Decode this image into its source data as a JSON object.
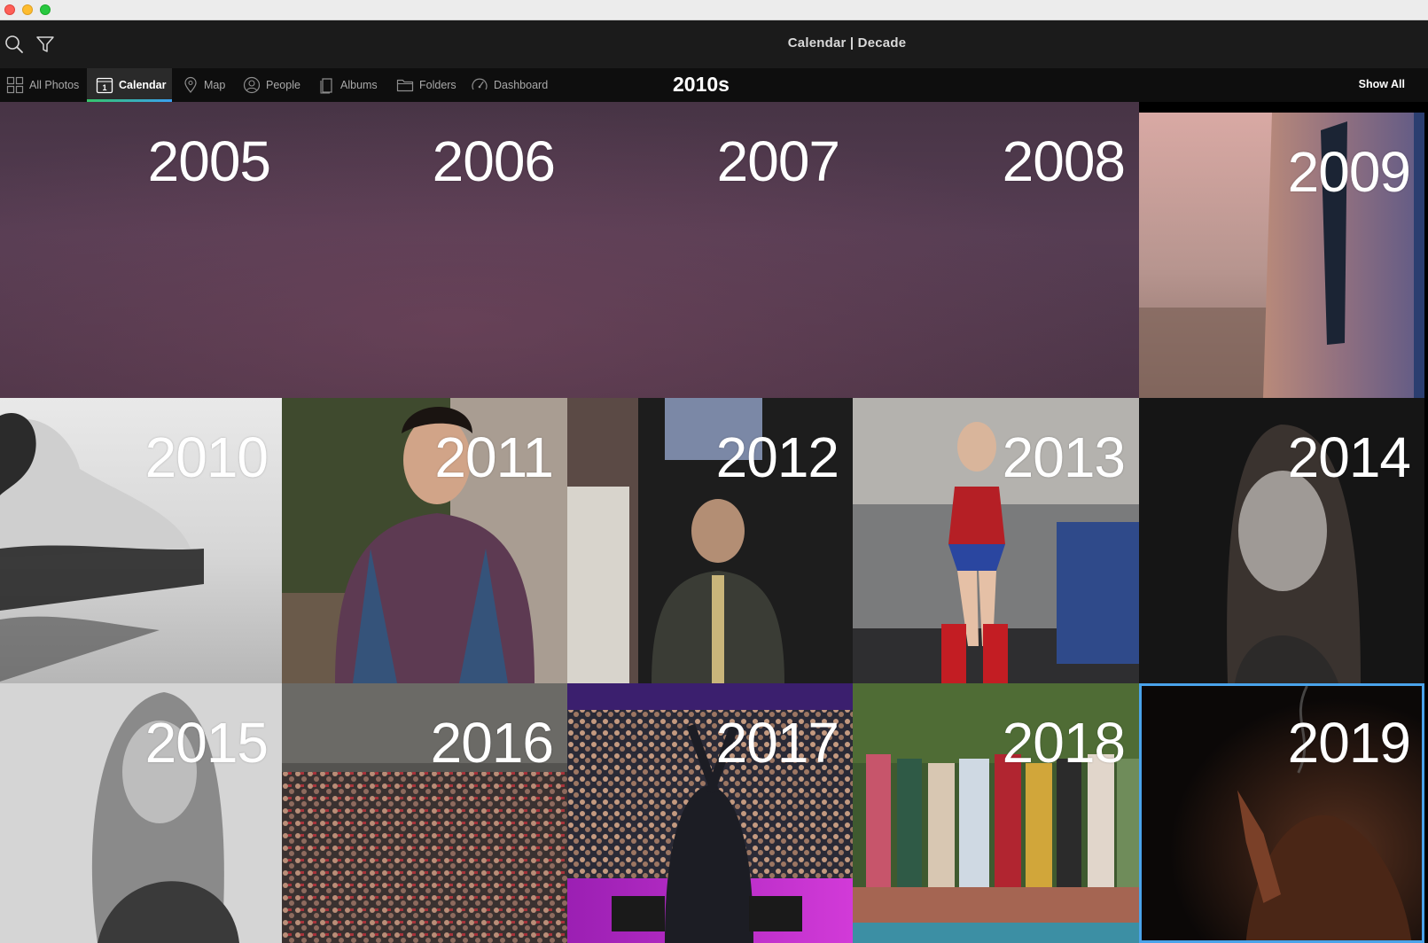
{
  "window": {
    "title": "Calendar | Decade"
  },
  "nav": {
    "items": [
      {
        "label": "All Photos",
        "icon": "grid-icon"
      },
      {
        "label": "Calendar",
        "icon": "calendar-icon",
        "active": true
      },
      {
        "label": "Map",
        "icon": "map-pin-icon"
      },
      {
        "label": "People",
        "icon": "person-icon"
      },
      {
        "label": "Albums",
        "icon": "album-icon"
      },
      {
        "label": "Folders",
        "icon": "folder-icon"
      },
      {
        "label": "Dashboard",
        "icon": "gauge-icon"
      }
    ],
    "decade": "2010s",
    "show_all": "Show All"
  },
  "colors": {
    "accent_selected": "#4aa3ea",
    "tab_underline_start": "#36c46a",
    "tab_underline_end": "#3aa0f2"
  },
  "years": [
    {
      "year": "2005",
      "has_photo": false
    },
    {
      "year": "2006",
      "has_photo": false
    },
    {
      "year": "2007",
      "has_photo": false
    },
    {
      "year": "2008",
      "has_photo": false
    },
    {
      "year": "2009",
      "has_photo": true
    },
    {
      "year": "2010",
      "has_photo": true
    },
    {
      "year": "2011",
      "has_photo": true
    },
    {
      "year": "2012",
      "has_photo": true
    },
    {
      "year": "2013",
      "has_photo": true
    },
    {
      "year": "2014",
      "has_photo": true
    },
    {
      "year": "2015",
      "has_photo": true
    },
    {
      "year": "2016",
      "has_photo": true
    },
    {
      "year": "2017",
      "has_photo": true
    },
    {
      "year": "2018",
      "has_photo": true
    },
    {
      "year": "2019",
      "has_photo": true,
      "selected": true
    }
  ]
}
